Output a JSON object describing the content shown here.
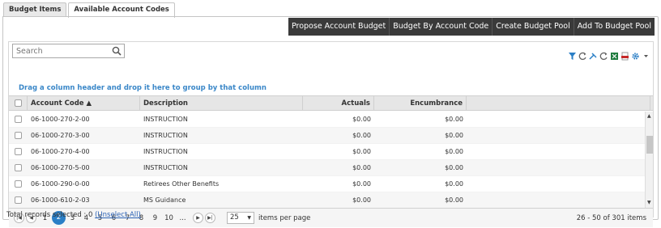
{
  "tabs": [
    "Budget Items",
    "Available Account Codes"
  ],
  "actions": [
    "Propose Account Budget",
    "Budget By Account Code",
    "Create Budget Pool",
    "Add To Budget Pool"
  ],
  "search": {
    "placeholder": "Search"
  },
  "group_hint": "Drag a column header and drop it here to group by that column",
  "columns": [
    "",
    "Account Code ▲",
    "Description",
    "Actuals",
    "Encumbrance",
    ""
  ],
  "rows": [
    {
      "code": "06-1000-270-2-00",
      "desc": "INSTRUCTION",
      "actuals": "$0.00",
      "enc": "$0.00"
    },
    {
      "code": "06-1000-270-3-00",
      "desc": "INSTRUCTION",
      "actuals": "$0.00",
      "enc": "$0.00"
    },
    {
      "code": "06-1000-270-4-00",
      "desc": "INSTRUCTION",
      "actuals": "$0.00",
      "enc": "$0.00"
    },
    {
      "code": "06-1000-270-5-00",
      "desc": "INSTRUCTION",
      "actuals": "$0.00",
      "enc": "$0.00"
    },
    {
      "code": "06-1000-290-0-00",
      "desc": "Retirees Other Benefits",
      "actuals": "$0.00",
      "enc": "$0.00"
    },
    {
      "code": "06-1000-610-2-03",
      "desc": "MS Guidance",
      "actuals": "$0.00",
      "enc": "$0.00"
    }
  ],
  "pager": {
    "pages": [
      "1",
      "2",
      "3",
      "4",
      "5",
      "6",
      "7",
      "8",
      "9",
      "10",
      "..."
    ],
    "current": "2",
    "page_size": "25",
    "page_size_label": "items per page",
    "range": "26 - 50 of 301 items"
  },
  "footer": {
    "text": "Total records selected : 0",
    "link": "(Unselect All)"
  },
  "colors": {
    "action_bg": "#3a3a3a",
    "accent": "#2b7fc6",
    "hint": "#3a87c8"
  }
}
